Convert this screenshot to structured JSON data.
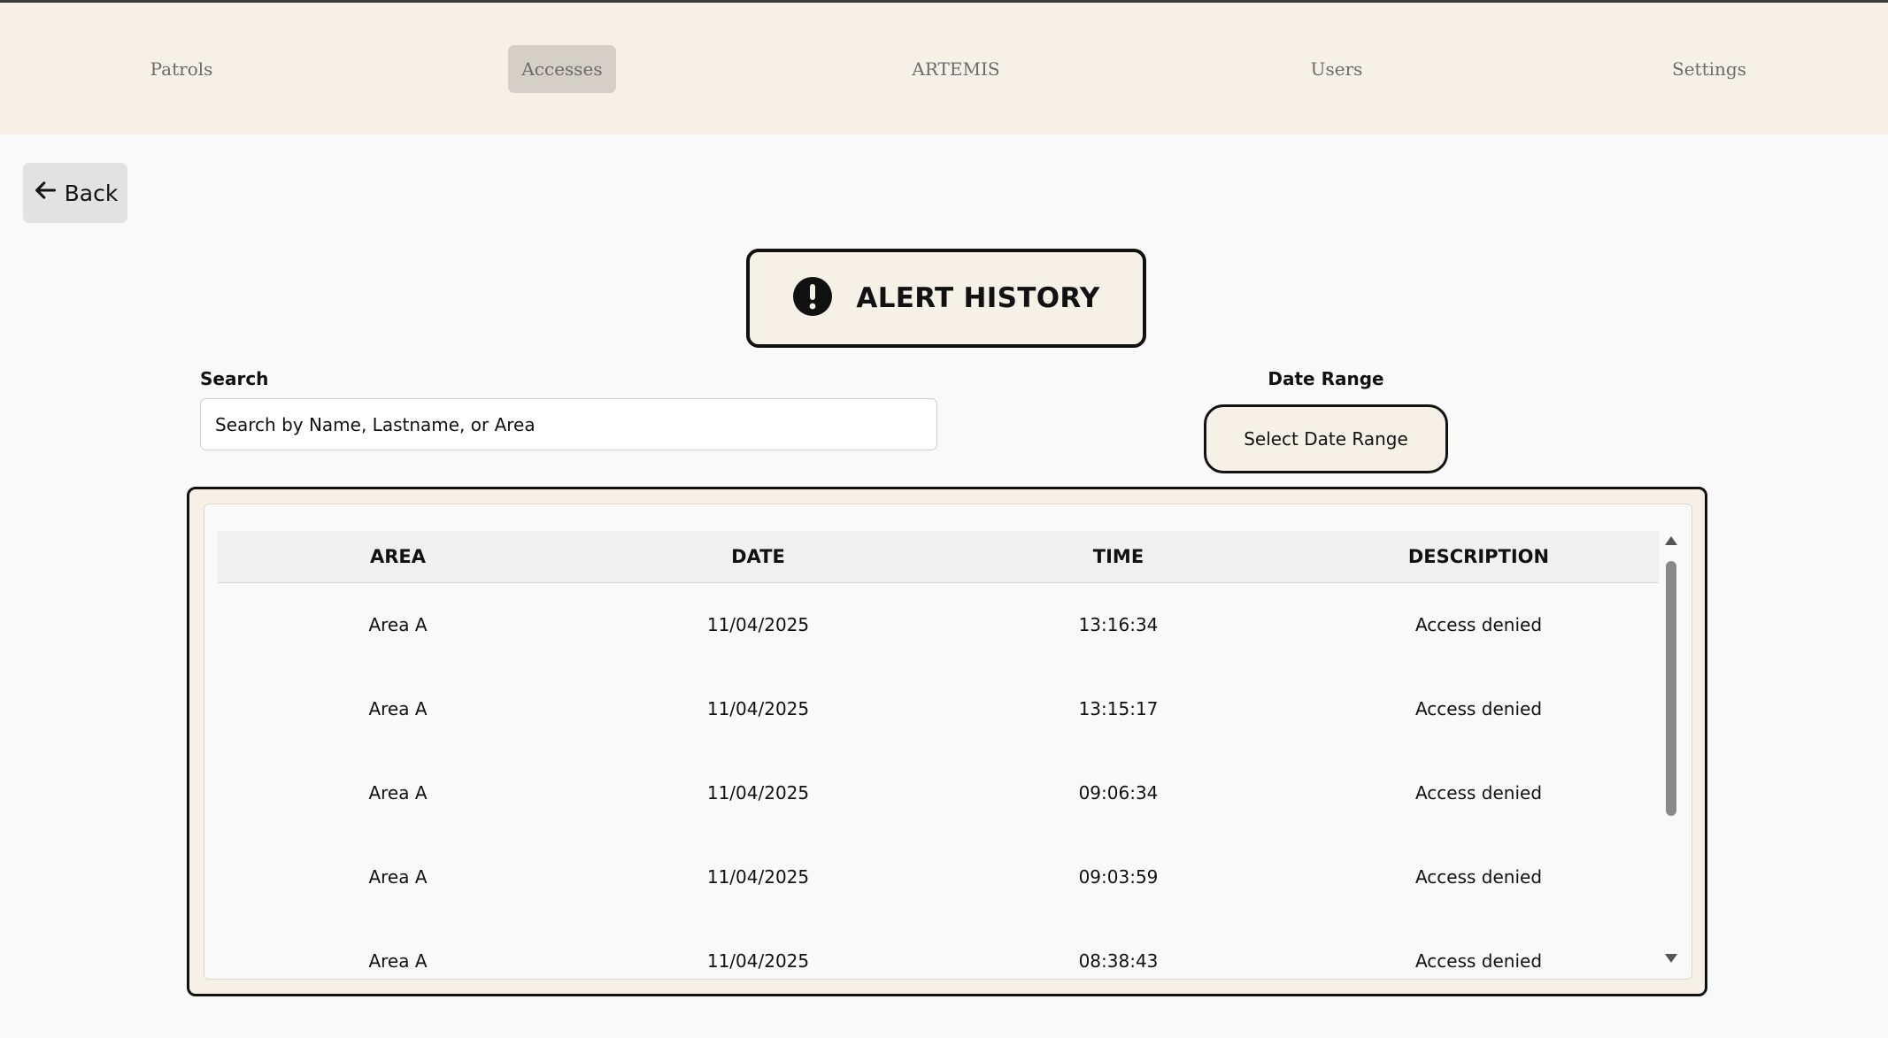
{
  "nav": {
    "items": [
      {
        "label": "Patrols"
      },
      {
        "label": "Accesses"
      },
      {
        "label": "ARTEMIS"
      },
      {
        "label": "Users"
      },
      {
        "label": "Settings"
      }
    ],
    "active": "Accesses"
  },
  "back": {
    "label": "Back"
  },
  "title": {
    "text": "ALERT HISTORY",
    "icon": "exclamation-circle-icon"
  },
  "search": {
    "label": "Search",
    "placeholder": "Search by Name, Lastname, or Area",
    "value": ""
  },
  "date_range": {
    "label": "Date Range",
    "button_label": "Select Date Range"
  },
  "table": {
    "columns": [
      "AREA",
      "DATE",
      "TIME",
      "DESCRIPTION"
    ],
    "rows": [
      {
        "area": "Area A",
        "date": "11/04/2025",
        "time": "13:16:34",
        "description": "Access denied"
      },
      {
        "area": "Area A",
        "date": "11/04/2025",
        "time": "13:15:17",
        "description": "Access denied"
      },
      {
        "area": "Area A",
        "date": "11/04/2025",
        "time": "09:06:34",
        "description": "Access denied"
      },
      {
        "area": "Area A",
        "date": "11/04/2025",
        "time": "09:03:59",
        "description": "Access denied"
      },
      {
        "area": "Area A",
        "date": "11/04/2025",
        "time": "08:38:43",
        "description": "Access denied"
      }
    ]
  },
  "colors": {
    "nav_background": "#f5f1e6",
    "nav_active": "#d4d0c7",
    "panel_background": "#f5f1e6",
    "border": "#111111",
    "page_background": "#f9f9f9"
  }
}
